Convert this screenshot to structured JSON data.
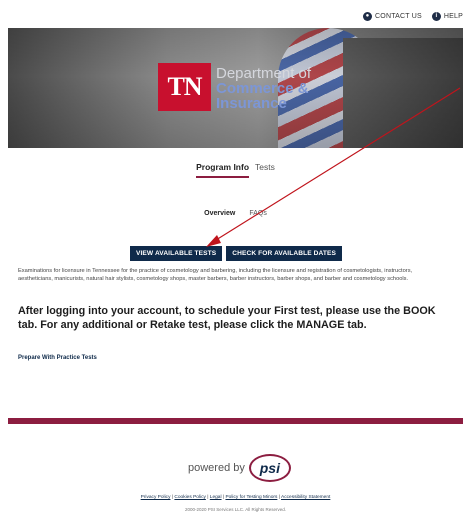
{
  "topbar": {
    "contact_label": "CONTACT US",
    "help_label": "HELP"
  },
  "hero": {
    "logo_mark": "TN",
    "logo_line1": "Department of",
    "logo_line2": "Commerce &",
    "logo_line3": "Insurance"
  },
  "tabs": [
    {
      "label": "Program Info",
      "active": true
    },
    {
      "label": "Tests",
      "active": false
    }
  ],
  "subtabs": [
    {
      "label": "Overview",
      "active": true
    },
    {
      "label": "FAQs",
      "active": false
    }
  ],
  "buttons": {
    "view_tests": "VIEW AVAILABLE TESTS",
    "check_dates": "CHECK FOR AVAILABLE DATES"
  },
  "description": "Examinations for licensure in Tennessee for the practice of cosmetology and barbering, including the licensure and registration of cosmetologists, instructors, aestheticians, manicurists, natural hair stylists, cosmetology shops, master barbers, barber instructors, barber shops, and barber and cosmetology schools.",
  "notice": "After logging into your account, to schedule your First test, please use the BOOK tab. For any additional or Retake test, please click the MANAGE tab.",
  "practice_link": "Prepare With Practice Tests",
  "footer": {
    "powered_by": "powered by",
    "psi_logo": "psi",
    "links": [
      "Privacy Policy",
      "Cookies Policy",
      "Legal",
      "Policy for Testing Minors",
      "Accessibility Statement"
    ],
    "copyright": "2000-2020 PSI Services LLC. All Rights Reserved."
  },
  "colors": {
    "brand_maroon": "#8c1d40",
    "navy": "#0f2a4a",
    "annotation_arrow": "#c0141c"
  }
}
